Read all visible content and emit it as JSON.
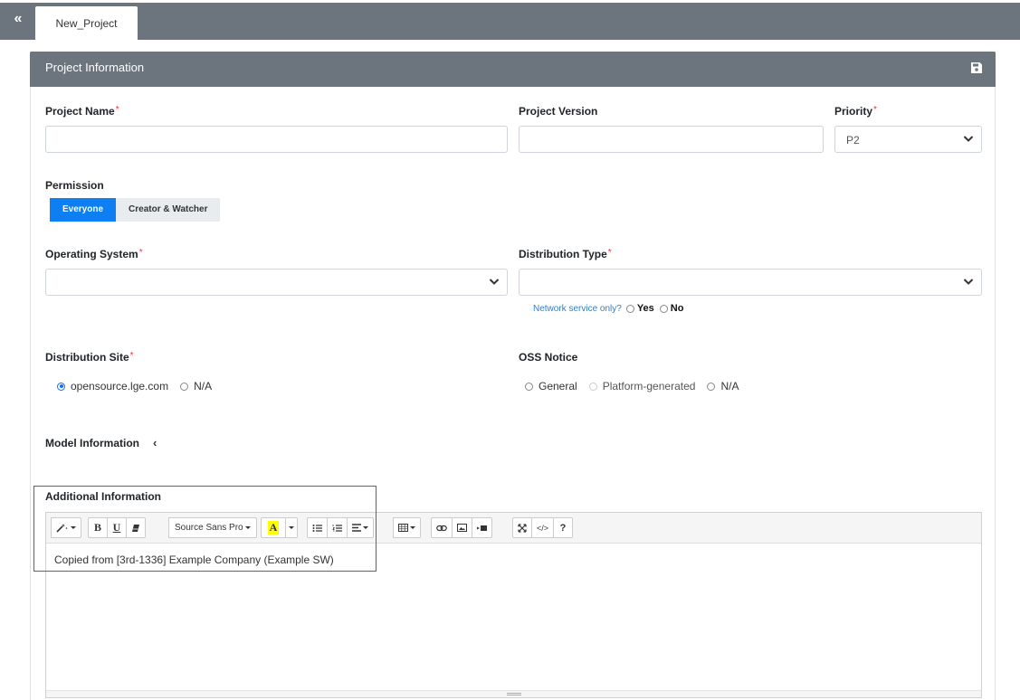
{
  "topbar": {
    "collapse_icon": "double-chevron-left-icon",
    "tab_label": "New_Project"
  },
  "panel": {
    "title": "Project Information",
    "save_icon": "floppy-disk-icon"
  },
  "fields": {
    "project_name": {
      "label": "Project Name",
      "required": "*",
      "value": ""
    },
    "project_version": {
      "label": "Project Version",
      "value": ""
    },
    "priority": {
      "label": "Priority",
      "required": "*",
      "value": "P2"
    },
    "permission": {
      "label": "Permission",
      "options": [
        "Everyone",
        "Creator & Watcher"
      ],
      "selected": "Everyone"
    },
    "operating_system": {
      "label": "Operating System",
      "required": "*",
      "value": ""
    },
    "distribution_type": {
      "label": "Distribution Type",
      "required": "*",
      "value": ""
    },
    "network_service": {
      "question": "Network service only?",
      "yes": "Yes",
      "no": "No"
    },
    "distribution_site": {
      "label": "Distribution Site",
      "required": "*",
      "options": [
        "opensource.lge.com",
        "N/A"
      ],
      "selected": "opensource.lge.com"
    },
    "oss_notice": {
      "label": "OSS Notice",
      "options": [
        "General",
        "Platform-generated",
        "N/A"
      ]
    },
    "model_information": {
      "label": "Model Information",
      "toggle_icon": "chevron-left-icon"
    },
    "additional_information": {
      "label": "Additional Information",
      "font_select": "Source Sans Pro",
      "content": "Copied from [3rd-1336] Example Company (Example SW)"
    }
  },
  "colors": {
    "header_gray": "#6c757d",
    "primary_blue": "#0d7ff2",
    "required_red": "#dc3545",
    "link_blue": "#2a7fd4",
    "highlight_red": "#e0301e"
  }
}
